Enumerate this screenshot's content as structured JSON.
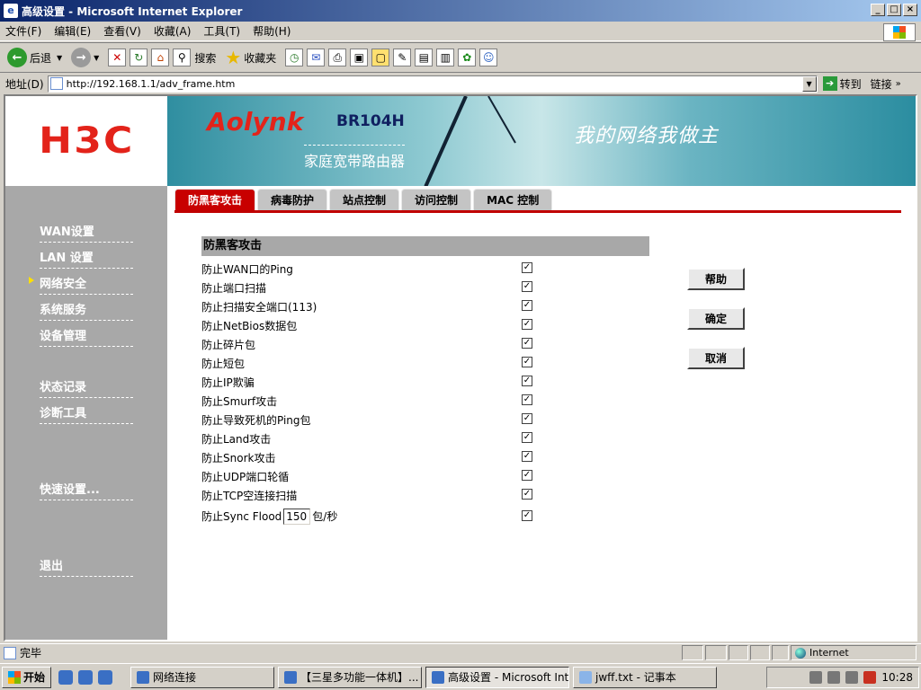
{
  "window": {
    "title": "高级设置 - Microsoft Internet Explorer"
  },
  "menu": [
    "文件(F)",
    "编辑(E)",
    "查看(V)",
    "收藏(A)",
    "工具(T)",
    "帮助(H)"
  ],
  "toolbar": {
    "back": "后退",
    "search": "搜索",
    "favorites": "收藏夹"
  },
  "address": {
    "label": "地址(D)",
    "url": "http://192.168.1.1/adv_frame.htm",
    "go": "转到",
    "links": "链接"
  },
  "brand": {
    "logo": "H3C",
    "product": "Aolynk",
    "model": "BR104H",
    "subtitle": "家庭宽带路由器",
    "slogan": "我的网络我做主"
  },
  "nav": [
    {
      "label": "WAN设置"
    },
    {
      "label": "LAN 设置"
    },
    {
      "label": "网络安全",
      "active": true
    },
    {
      "label": "系统服务"
    },
    {
      "label": "设备管理"
    },
    {
      "label": "状态记录"
    },
    {
      "label": "诊断工具"
    },
    {
      "label": "快速设置..."
    },
    {
      "label": "退出"
    }
  ],
  "tabs": [
    "防黑客攻击",
    "病毒防护",
    "站点控制",
    "访问控制",
    "MAC 控制"
  ],
  "section": {
    "title": "防黑客攻击",
    "items": [
      {
        "label": "防止WAN口的Ping",
        "checked": true
      },
      {
        "label": "防止端口扫描",
        "checked": true
      },
      {
        "label": "防止扫描安全端口(113)",
        "checked": true
      },
      {
        "label": "防止NetBios数据包",
        "checked": true
      },
      {
        "label": "防止碎片包",
        "checked": true
      },
      {
        "label": "防止短包",
        "checked": true
      },
      {
        "label": "防止IP欺骗",
        "checked": true
      },
      {
        "label": "防止Smurf攻击",
        "checked": true
      },
      {
        "label": "防止导致死机的Ping包",
        "checked": true
      },
      {
        "label": "防止Land攻击",
        "checked": true
      },
      {
        "label": "防止Snork攻击",
        "checked": true
      },
      {
        "label": "防止UDP端口轮循",
        "checked": true
      },
      {
        "label": "防止TCP空连接扫描",
        "checked": true
      }
    ],
    "sync": {
      "prefix": "防止Sync Flood",
      "value": "150",
      "unit": "包/秒",
      "checked": true
    }
  },
  "buttons": {
    "help": "帮助",
    "ok": "确定",
    "cancel": "取消"
  },
  "status": {
    "text": "完毕",
    "zone": "Internet"
  },
  "taskbar": {
    "start": "开始",
    "tasks": [
      "网络连接",
      "【三星多功能一体机】...",
      "高级设置 - Microsoft Int...",
      "jwff.txt - 记事本"
    ],
    "active_task": 2,
    "clock": "10:28"
  }
}
